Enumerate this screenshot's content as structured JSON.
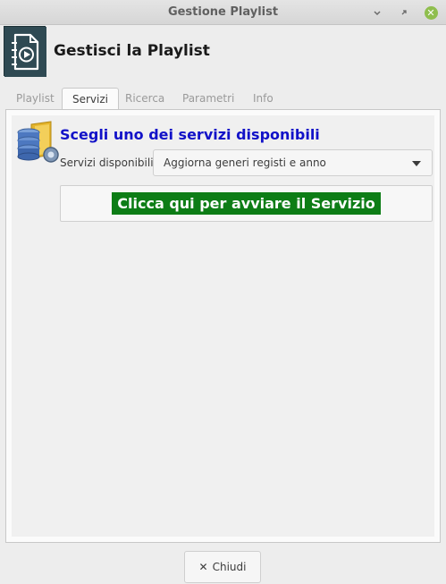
{
  "window": {
    "title": "Gestione Playlist",
    "controls": {
      "minimize": "⌄",
      "maximize": "˄",
      "close": "✕"
    }
  },
  "header": {
    "title": "Gestisci la Playlist",
    "icon": "playlist-video-icon"
  },
  "tabs": [
    {
      "label": "Playlist",
      "active": false
    },
    {
      "label": "Servizi",
      "active": true
    },
    {
      "label": "Ricerca",
      "active": false
    },
    {
      "label": "Parametri",
      "active": false
    },
    {
      "label": "Info",
      "active": false
    }
  ],
  "services": {
    "icon": "database-service-icon",
    "heading": "Scegli uno dei servizi disponibili",
    "select_label": "Servizi disponibili:",
    "selected_value": "Aggiorna generi registi e anno",
    "start_button": "Clicca qui per avviare il Servizio",
    "start_button_color": "#0d7d16",
    "heading_color": "#1212c8"
  },
  "footer": {
    "close_icon": "✕",
    "close_label": "Chiudi"
  }
}
